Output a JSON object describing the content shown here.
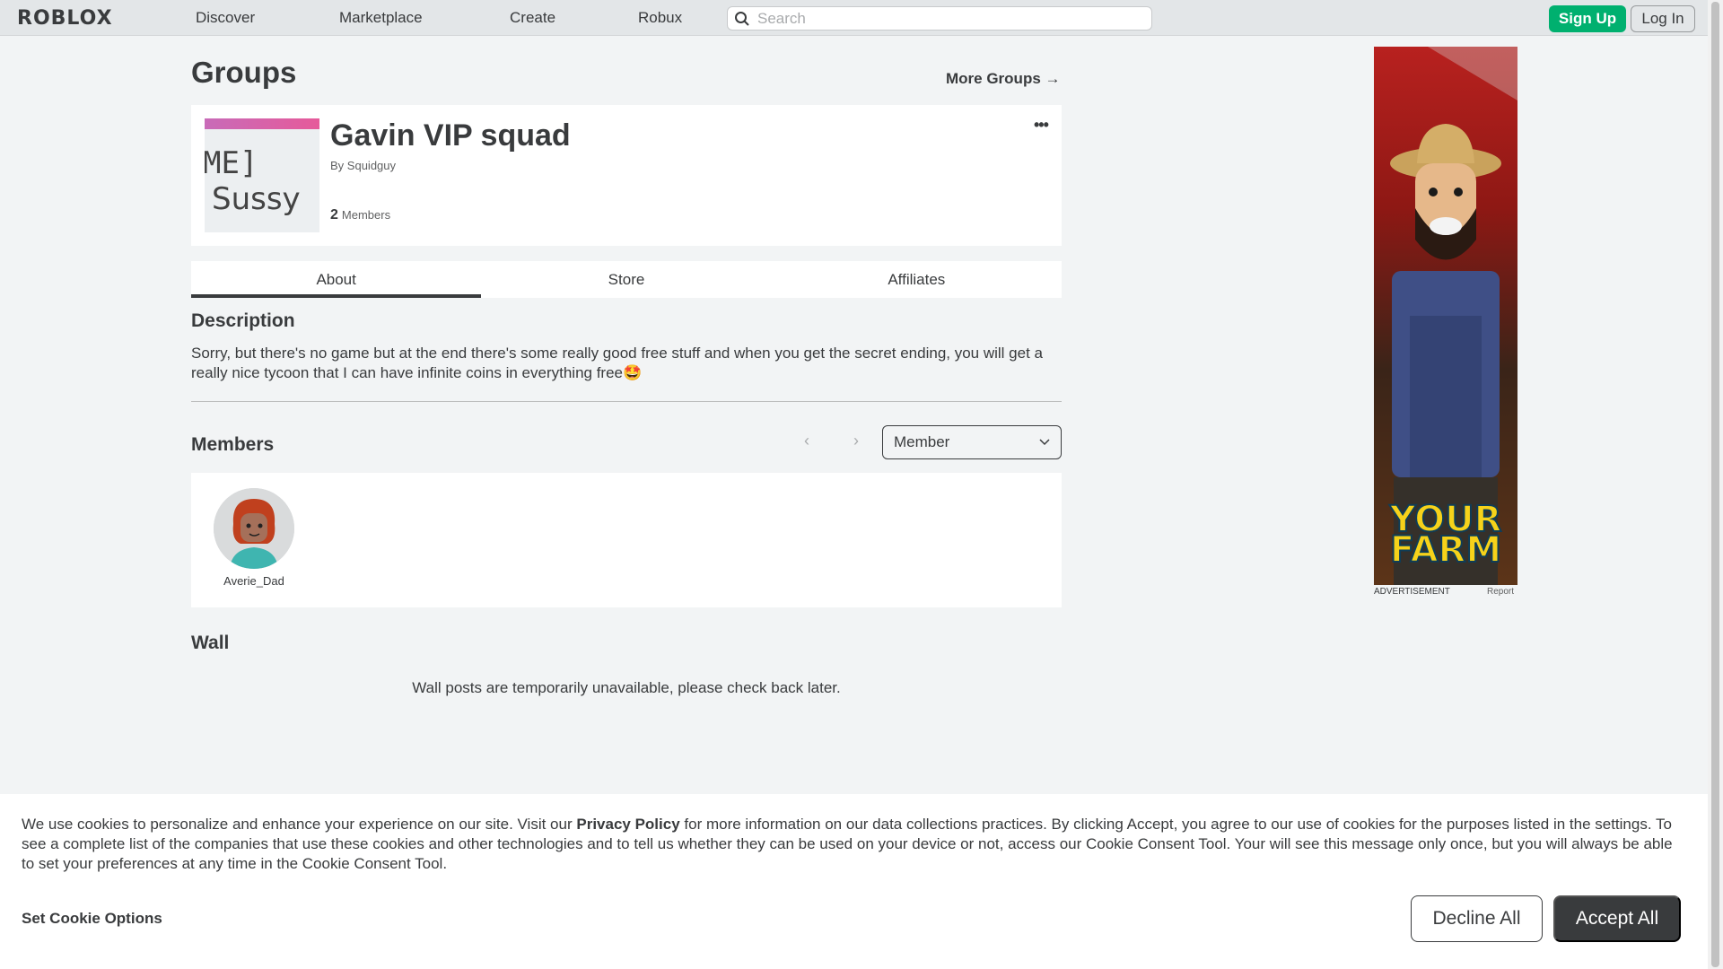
{
  "nav": {
    "logo": "ROBLOX",
    "links": [
      "Discover",
      "Marketplace",
      "Create",
      "Robux"
    ],
    "search_placeholder": "Search",
    "signup_label": "Sign Up",
    "login_label": "Log In"
  },
  "page": {
    "title": "Groups",
    "more_groups": "More Groups →"
  },
  "group": {
    "name": "Gavin VIP squad",
    "by_prefix": "By",
    "owner": "Squidguy",
    "member_count": "2",
    "member_label": "Members",
    "thumb_text_1": "ME]",
    "thumb_text_2": "Sussy",
    "more_icon": "•••"
  },
  "tabs": [
    {
      "label": "About"
    },
    {
      "label": "Store"
    },
    {
      "label": "Affiliates"
    }
  ],
  "about": {
    "description_heading": "Description",
    "description": "Sorry, but there's no game but at the end there's some really good free stuff and when you get the secret ending, you will get a really nice tycoon that I can have infinite coins in everything free🤩",
    "members_heading": "Members",
    "role_filter": "Member",
    "members": [
      {
        "name": "Averie_Dad"
      }
    ],
    "wall_heading": "Wall",
    "wall_note": "Wall posts are temporarily unavailable, please check back later."
  },
  "ad": {
    "label": "ADVERTISEMENT",
    "report": "Report",
    "brand_line1": "YOUR",
    "brand_line2": "FARM"
  },
  "cookie": {
    "text_before": "We use cookies to personalize and enhance your experience on our site. Visit our ",
    "privacy_link": "Privacy Policy",
    "text_after": " for more information on our data collections practices. By clicking Accept, you agree to our use of cookies for the purposes listed in the settings. To see a complete list of the companies that use these cookies and other technologies and to tell us whether they can be used on your device or not, access our Cookie Consent Tool. Your will see this message only once, but you will always be able to set your preferences at any time in the Cookie Consent Tool.",
    "set_options": "Set Cookie Options",
    "decline": "Decline All",
    "accept": "Accept All"
  },
  "colors": {
    "accent_green": "#00b06f",
    "text": "#393b3d",
    "background": "#f2f4f5"
  }
}
